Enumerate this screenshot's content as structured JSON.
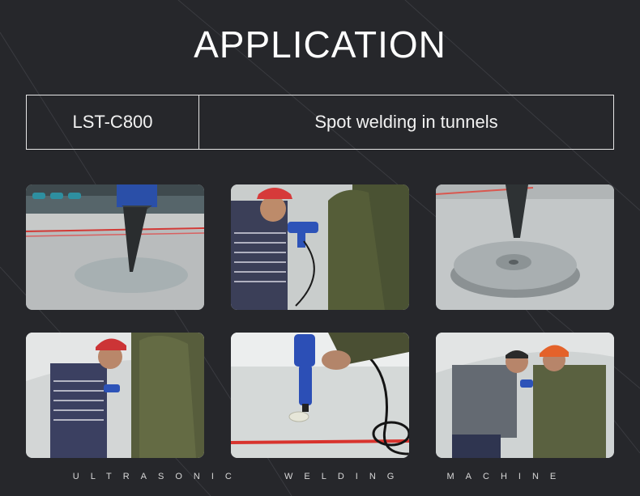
{
  "header": {
    "title": "APPLICATION"
  },
  "info": {
    "model": "LST-C800",
    "application": "Spot welding in tunnels"
  },
  "photos": [
    {
      "name": "photo-welder-tip-closeup"
    },
    {
      "name": "photo-worker-red-helmet-welding"
    },
    {
      "name": "photo-welded-disc-closeup"
    },
    {
      "name": "photo-two-workers-tunnel"
    },
    {
      "name": "photo-blue-welder-on-membrane"
    },
    {
      "name": "photo-worker-orange-helmet"
    }
  ],
  "footer": {
    "tagline": "ULTRASONIC   WELDING   MACHINE"
  },
  "colors": {
    "background": "#26272b",
    "text": "#ffffff",
    "border": "#e6e6e6"
  }
}
